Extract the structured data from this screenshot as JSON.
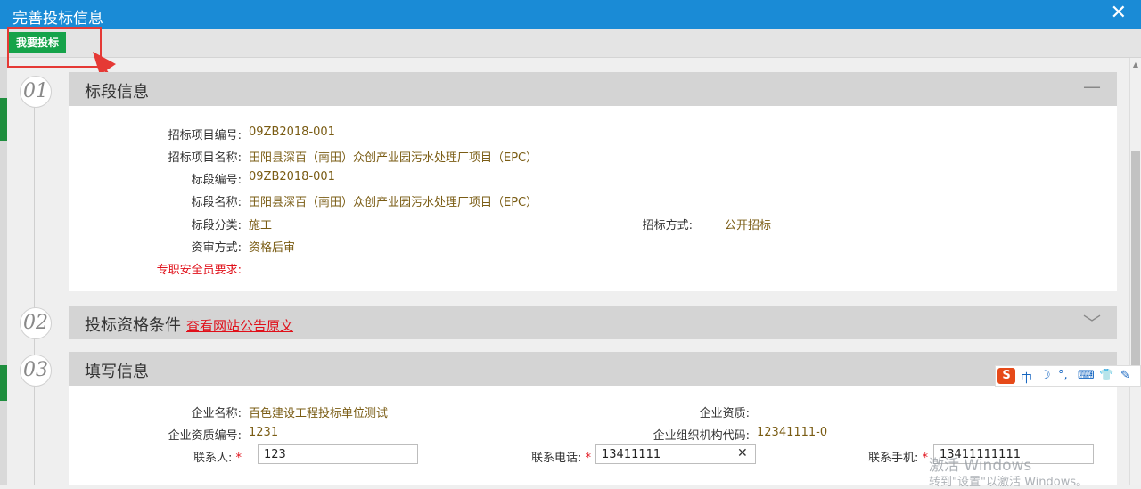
{
  "window": {
    "title": "完善投标信息",
    "close_glyph": "✕"
  },
  "toolbar": {
    "bid_label": "我要投标"
  },
  "sections": [
    {
      "num": "01",
      "title": "标段信息",
      "toggle_glyph": "—",
      "fields": [
        {
          "label": "招标项目编号:",
          "value": "09ZB2018-001"
        },
        {
          "label": "招标项目名称:",
          "value": "田阳县深百（南田）众创产业园污水处理厂项目（EPC）"
        },
        {
          "label": "标段编号:",
          "value": "09ZB2018-001"
        },
        {
          "label": "标段名称:",
          "value": "田阳县深百（南田）众创产业园污水处理厂项目（EPC）"
        },
        {
          "label": "标段分类:",
          "value": "施工"
        },
        {
          "label": "招标方式:",
          "value": "公开招标"
        },
        {
          "label": "资审方式:",
          "value": "资格后审"
        },
        {
          "label": "专职安全员要求:",
          "value": ""
        }
      ]
    },
    {
      "num": "02",
      "title": "投标资格条件",
      "link": "查看网站公告原文",
      "toggle_glyph": "﹀"
    },
    {
      "num": "03",
      "title": "填写信息",
      "fields": [
        {
          "label": "企业名称:",
          "value": "百色建设工程投标单位测试"
        },
        {
          "label": "企业资质:",
          "value": ""
        },
        {
          "label": "企业资质编号:",
          "value": "1231"
        },
        {
          "label": "企业组织机构代码:",
          "value": "12341111-0"
        }
      ],
      "inputs": [
        {
          "label": "联系人:",
          "value": "123"
        },
        {
          "label": "联系电话:",
          "value": "13411111"
        },
        {
          "label": "联系手机:",
          "value": "13411111111"
        }
      ],
      "required_mark": "*",
      "clear_glyph": "✕"
    }
  ],
  "ime": {
    "logo": "S",
    "mode": "中",
    "items": [
      "☽",
      "°,",
      "⌨",
      "👕",
      "✎"
    ]
  },
  "watermark": {
    "line1": "激活 Windows",
    "line2": "转到\"设置\"以激活 Windows。"
  },
  "colors": {
    "titlebar": "#1a8bd6",
    "bid_button": "#16a34a",
    "required": "#e0101a",
    "value_text": "#7a5c14"
  }
}
